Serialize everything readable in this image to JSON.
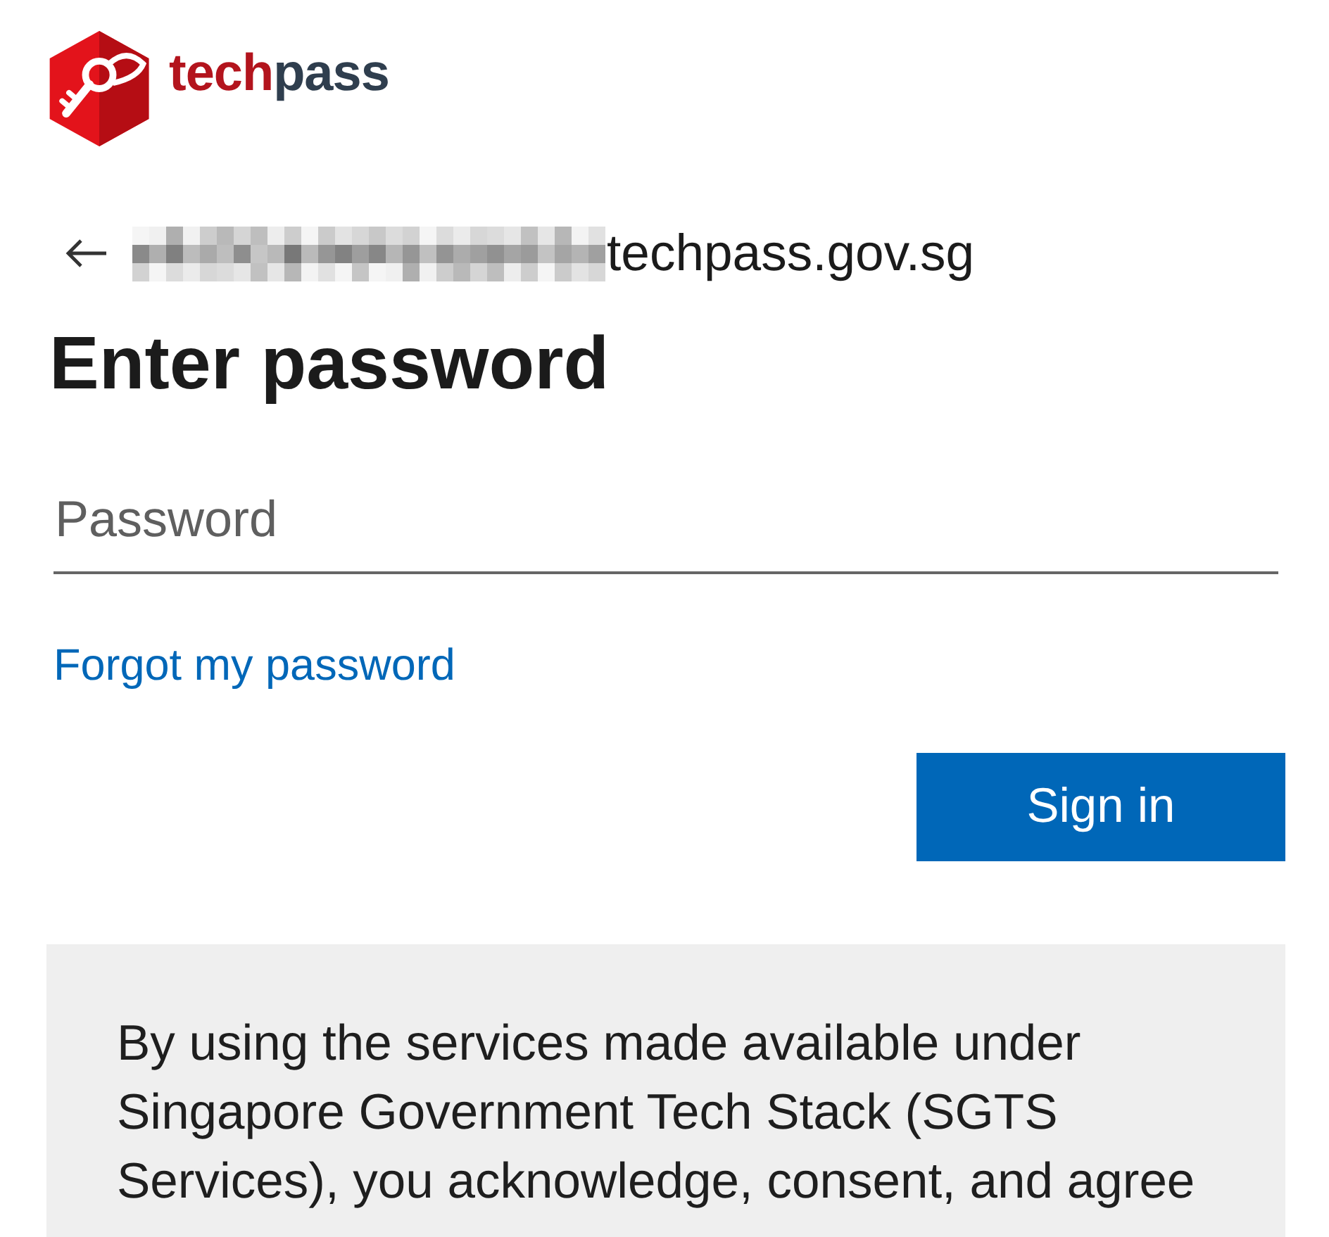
{
  "logo": {
    "wordmark": [
      {
        "text": "tech",
        "color": "#b3141d"
      },
      {
        "text": "pass",
        "color": "#2f3e4e"
      }
    ]
  },
  "account": {
    "redacted": true,
    "domain": "techpass.gov.sg"
  },
  "heading": "Enter password",
  "password_field": {
    "placeholder": "Password"
  },
  "forgot_link": "Forgot my password",
  "sign_in_button": "Sign in",
  "notice": {
    "text": "By using the services made available under Singapore Government Tech Stack (SGTS Services), you acknowledge, consent, and agree"
  }
}
